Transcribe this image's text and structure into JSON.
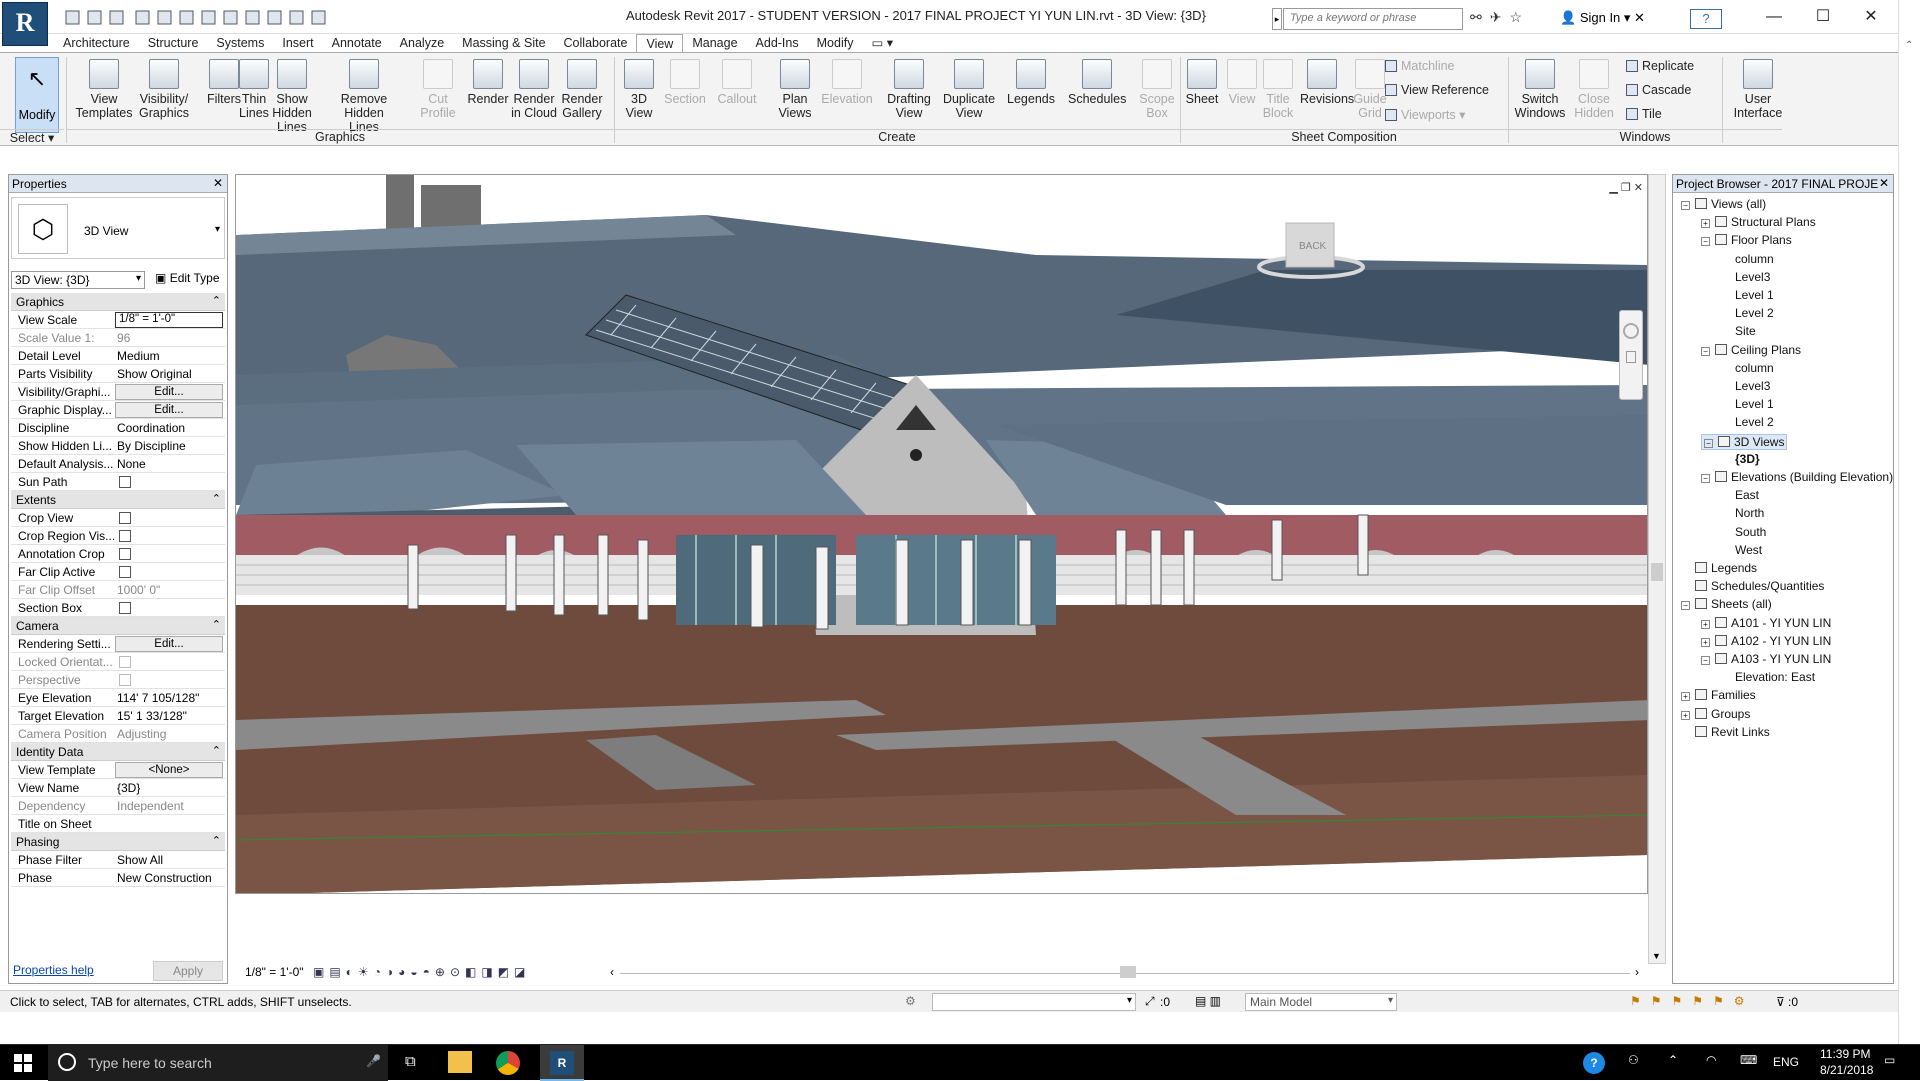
{
  "title": "Autodesk Revit 2017 - STUDENT VERSION -     2017 FINAL PROJECT YI YUN LIN.rvt - 3D View: {3D}",
  "app_logo": "R",
  "search_placeholder": "Type a keyword or phrase",
  "sign_in": "Sign In",
  "help": "?",
  "window": {
    "minimize": "—",
    "maximize": "☐",
    "close": "✕"
  },
  "tabs": [
    "Architecture",
    "Structure",
    "Systems",
    "Insert",
    "Annotate",
    "Analyze",
    "Massing & Site",
    "Collaborate",
    "View",
    "Manage",
    "Add-Ins",
    "Modify"
  ],
  "active_tab": "View",
  "ribbon": {
    "modify": "Modify",
    "select": "Select",
    "graphics_buttons": [
      {
        "label": "View\nTemplates",
        "enabled": true
      },
      {
        "label": "Visibility/\nGraphics",
        "enabled": true
      },
      {
        "label": "Filters",
        "enabled": true
      },
      {
        "label": "Thin\nLines",
        "enabled": true
      },
      {
        "label": "Show\nHidden Lines",
        "enabled": true
      },
      {
        "label": "Remove\nHidden Lines",
        "enabled": true
      },
      {
        "label": "Cut\nProfile",
        "enabled": false
      },
      {
        "label": "Render",
        "enabled": true
      },
      {
        "label": "Render\nin Cloud",
        "enabled": true
      },
      {
        "label": "Render\nGallery",
        "enabled": true
      }
    ],
    "create_buttons": [
      {
        "label": "3D\nView",
        "enabled": true
      },
      {
        "label": "Section",
        "enabled": false
      },
      {
        "label": "Callout",
        "enabled": false
      },
      {
        "label": "Plan\nViews",
        "enabled": true
      },
      {
        "label": "Elevation",
        "enabled": false
      },
      {
        "label": "Drafting\nView",
        "enabled": true
      },
      {
        "label": "Duplicate\nView",
        "enabled": true
      },
      {
        "label": "Legends",
        "enabled": true
      },
      {
        "label": "Schedules",
        "enabled": true
      },
      {
        "label": "Scope\nBox",
        "enabled": false
      }
    ],
    "sheet_buttons": [
      {
        "label": "Sheet",
        "enabled": true
      },
      {
        "label": "View",
        "enabled": false
      },
      {
        "label": "Title\nBlock",
        "enabled": false
      },
      {
        "label": "Revisions",
        "enabled": true
      },
      {
        "label": "Guide\nGrid",
        "enabled": false
      }
    ],
    "sheet_small": [
      "Matchline",
      "View Reference",
      "Viewports"
    ],
    "windows_buttons": [
      {
        "label": "Switch\nWindows",
        "enabled": true
      },
      {
        "label": "Close\nHidden",
        "enabled": false
      }
    ],
    "windows_small": [
      "Replicate",
      "Cascade",
      "Tile"
    ],
    "ui_button": "User\nInterface",
    "panels": {
      "graphics": "Graphics",
      "create": "Create",
      "sheet": "Sheet Composition",
      "windows": "Windows"
    }
  },
  "properties": {
    "header": "Properties",
    "type_name": "3D View",
    "view_selector": "3D View: {3D}",
    "edit_type": "Edit Type",
    "sections": [
      {
        "name": "Graphics",
        "rows": [
          {
            "k": "View Scale",
            "v": "1/8\" = 1'-0\"",
            "kind": "input"
          },
          {
            "k": "Scale Value    1:",
            "v": "96",
            "kind": "dim"
          },
          {
            "k": "Detail Level",
            "v": "Medium",
            "kind": "text"
          },
          {
            "k": "Parts Visibility",
            "v": "Show Original",
            "kind": "text"
          },
          {
            "k": "Visibility/Graphi...",
            "v": "Edit...",
            "kind": "button"
          },
          {
            "k": "Graphic Display...",
            "v": "Edit...",
            "kind": "button"
          },
          {
            "k": "Discipline",
            "v": "Coordination",
            "kind": "text"
          },
          {
            "k": "Show Hidden Li...",
            "v": "By Discipline",
            "kind": "text"
          },
          {
            "k": "Default Analysis...",
            "v": "None",
            "kind": "text"
          },
          {
            "k": "Sun Path",
            "v": "",
            "kind": "check"
          }
        ]
      },
      {
        "name": "Extents",
        "rows": [
          {
            "k": "Crop View",
            "v": "",
            "kind": "check"
          },
          {
            "k": "Crop Region Vis...",
            "v": "",
            "kind": "check"
          },
          {
            "k": "Annotation Crop",
            "v": "",
            "kind": "check"
          },
          {
            "k": "Far Clip Active",
            "v": "",
            "kind": "check"
          },
          {
            "k": "Far Clip Offset",
            "v": "1000'  0\"",
            "kind": "dim"
          },
          {
            "k": "Section Box",
            "v": "",
            "kind": "check"
          }
        ]
      },
      {
        "name": "Camera",
        "rows": [
          {
            "k": "Rendering Setti...",
            "v": "Edit...",
            "kind": "button"
          },
          {
            "k": "Locked Orientat...",
            "v": "",
            "kind": "dimcheck"
          },
          {
            "k": "Perspective",
            "v": "",
            "kind": "dimcheck"
          },
          {
            "k": "Eye Elevation",
            "v": "114'  7 105/128\"",
            "kind": "text"
          },
          {
            "k": "Target Elevation",
            "v": "15'  1 33/128\"",
            "kind": "text"
          },
          {
            "k": "Camera Position",
            "v": "Adjusting",
            "kind": "dim"
          }
        ]
      },
      {
        "name": "Identity Data",
        "rows": [
          {
            "k": "View Template",
            "v": "<None>",
            "kind": "button"
          },
          {
            "k": "View Name",
            "v": "{3D}",
            "kind": "text"
          },
          {
            "k": "Dependency",
            "v": "Independent",
            "kind": "dim"
          },
          {
            "k": "Title on Sheet",
            "v": "",
            "kind": "text"
          }
        ]
      },
      {
        "name": "Phasing",
        "rows": [
          {
            "k": "Phase Filter",
            "v": "Show All",
            "kind": "text"
          },
          {
            "k": "Phase",
            "v": "New Construction",
            "kind": "text"
          }
        ]
      }
    ],
    "help_link": "Properties help",
    "apply": "Apply"
  },
  "viewport": {
    "scale_label": "1/8\" = 1'-0\"",
    "viewcube_face": "BACK"
  },
  "browser": {
    "header": "Project Browser - 2017 FINAL PROJE...",
    "nodes": [
      {
        "label": "Views (all)",
        "level": 0,
        "toggle": "−"
      },
      {
        "label": "Structural Plans",
        "level": 1,
        "toggle": "+"
      },
      {
        "label": "Floor Plans",
        "level": 1,
        "toggle": "−"
      },
      {
        "label": "column",
        "level": 2
      },
      {
        "label": "Level3",
        "level": 2
      },
      {
        "label": "Level 1",
        "level": 2
      },
      {
        "label": "Level 2",
        "level": 2
      },
      {
        "label": "Site",
        "level": 2
      },
      {
        "label": "Ceiling Plans",
        "level": 1,
        "toggle": "−"
      },
      {
        "label": "column",
        "level": 2
      },
      {
        "label": "Level3",
        "level": 2
      },
      {
        "label": "Level 1",
        "level": 2
      },
      {
        "label": "Level 2",
        "level": 2
      },
      {
        "label": "3D Views",
        "level": 1,
        "toggle": "−",
        "selected": true
      },
      {
        "label": "{3D}",
        "level": 2,
        "bold": true
      },
      {
        "label": "Elevations (Building Elevation)",
        "level": 1,
        "toggle": "−"
      },
      {
        "label": "East",
        "level": 2
      },
      {
        "label": "North",
        "level": 2
      },
      {
        "label": "South",
        "level": 2
      },
      {
        "label": "West",
        "level": 2
      },
      {
        "label": "Legends",
        "level": 0,
        "icon": true
      },
      {
        "label": "Schedules/Quantities",
        "level": 0,
        "icon": true
      },
      {
        "label": "Sheets (all)",
        "level": 0,
        "toggle": "−",
        "icon": true
      },
      {
        "label": "A101 - YI YUN LIN",
        "level": 1,
        "toggle": "+"
      },
      {
        "label": "A102 - YI YUN LIN",
        "level": 1,
        "toggle": "+"
      },
      {
        "label": "A103 - YI YUN LIN",
        "level": 1,
        "toggle": "−"
      },
      {
        "label": "Elevation: East",
        "level": 2
      },
      {
        "label": "Families",
        "level": 0,
        "toggle": "+",
        "icon": true
      },
      {
        "label": "Groups",
        "level": 0,
        "toggle": "+",
        "icon": true
      },
      {
        "label": "Revit Links",
        "level": 0,
        "icon": true
      }
    ]
  },
  "status": {
    "hint": "Click to select, TAB for alternates, CTRL adds, SHIFT unselects.",
    "selection_count": ":0",
    "model": "Main Model",
    "filter_count": ":0"
  },
  "taskbar": {
    "search": "Type here to search",
    "lang": "ENG",
    "time": "11:39 PM",
    "date": "8/21/2018"
  },
  "colors": {
    "accent": "#3a6ea5",
    "roof": "#5b6e80",
    "brick": "#a15b62",
    "ground": "#6e4b3d"
  }
}
